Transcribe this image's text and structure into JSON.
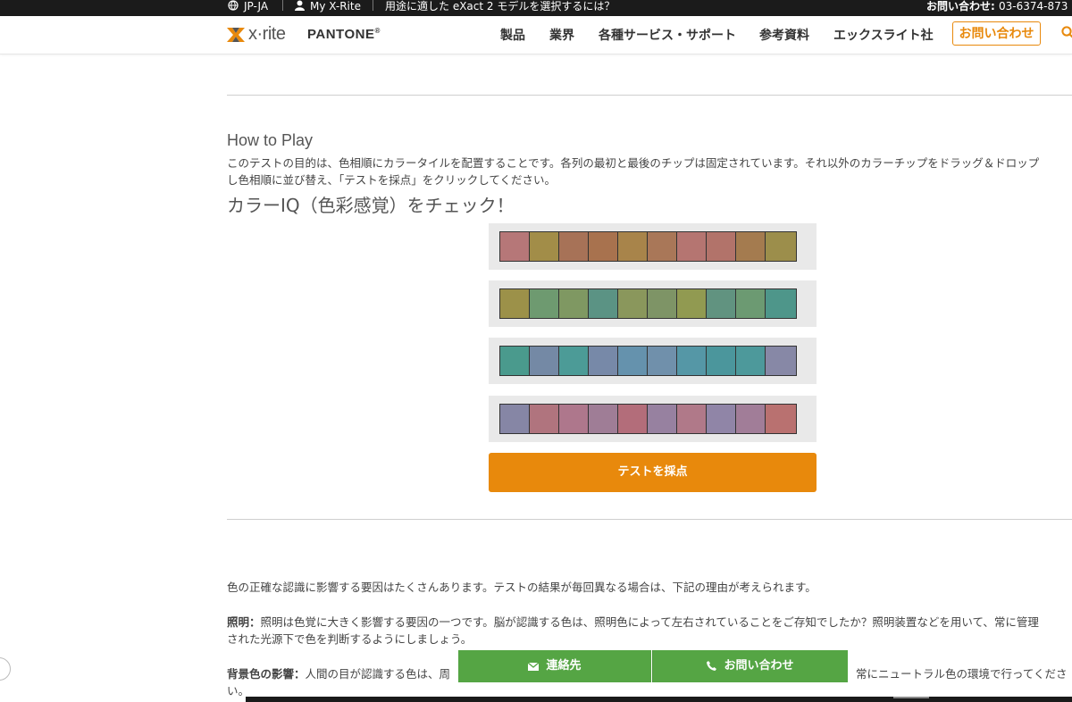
{
  "topbar": {
    "region": "JP-JA",
    "account": "My X-Rite",
    "promo": "用途に適した eXact 2 モデルを選択するには？",
    "phone_label": "お問い合わせ:",
    "phone_number": "03-6374-873"
  },
  "header": {
    "brand": "x·rite",
    "partner": "PANTONE",
    "partner_mark": "®",
    "nav": [
      "製品",
      "業界",
      "各種サービス・サポート",
      "参考資料",
      "エックスライト社"
    ],
    "contact_button": "お問い合わせ"
  },
  "content": {
    "heading": "How to Play",
    "instructions_line1": "このテストの目的は、色相順にカラータイルを配置することです。各列の最初と最後のチップは固定されています。それ以外のカラーチップをドラッグ＆ドロップ",
    "instructions_line2": "し色相順に並び替え、「テストを採点」をクリックしてください。",
    "check_title": "カラーIQ（色彩感覚）をチェック！",
    "rows": [
      [
        "#b67778",
        "#a28d48",
        "#a77257",
        "#a8724e",
        "#a8844a",
        "#a97758",
        "#b57571",
        "#b2736a",
        "#a47b4f",
        "#9c8e4b"
      ],
      [
        "#9c9149",
        "#6e9a70",
        "#7f9862",
        "#5b9384",
        "#8a975c",
        "#7e9466",
        "#919a51",
        "#619380",
        "#6c9a72",
        "#4e968a"
      ],
      [
        "#4a9a8d",
        "#7489a5",
        "#4c9b97",
        "#7789a8",
        "#6592ad",
        "#7090ab",
        "#5597a6",
        "#4b969c",
        "#4d999b",
        "#8788a6"
      ],
      [
        "#8686a5",
        "#b0747e",
        "#ae778c",
        "#9f7d96",
        "#b36d7a",
        "#9781a0",
        "#b07989",
        "#9085a7",
        "#a17d98",
        "#b97170"
      ]
    ],
    "score_button": "テストを採点",
    "body_intro": "色の正確な認識に影響する要因はたくさんあります。テストの結果が毎回異なる場合は、下記の理由が考えられます。",
    "lighting_label": "照明：",
    "lighting_text_1": "照明は色覚に大きく影響する要因の一つです。脳が認識する色は、照明色によって左右されていることをご存知でしたか？照明装置などを用いて、常に管理",
    "lighting_text_2": "された光源下で色を判断するようにしましょう。",
    "background_label": "背景色の影響：",
    "background_text_left": "人間の目が認識する色は、周",
    "background_text_right": "常にニュートラル色の環境で行ってくださ",
    "background_text_end": "い。"
  },
  "floating_bar": {
    "contact_link": "連絡先",
    "inquiry_link": "お問い合わせ"
  },
  "colors": {
    "accent": "#e8890c",
    "float_green": "#55a544",
    "topbar_bg": "#1b1b1b"
  },
  "icons": {
    "region": "globe-icon",
    "account": "user-icon",
    "search": "search-icon",
    "mail": "mail-icon",
    "phone": "phone-icon"
  }
}
